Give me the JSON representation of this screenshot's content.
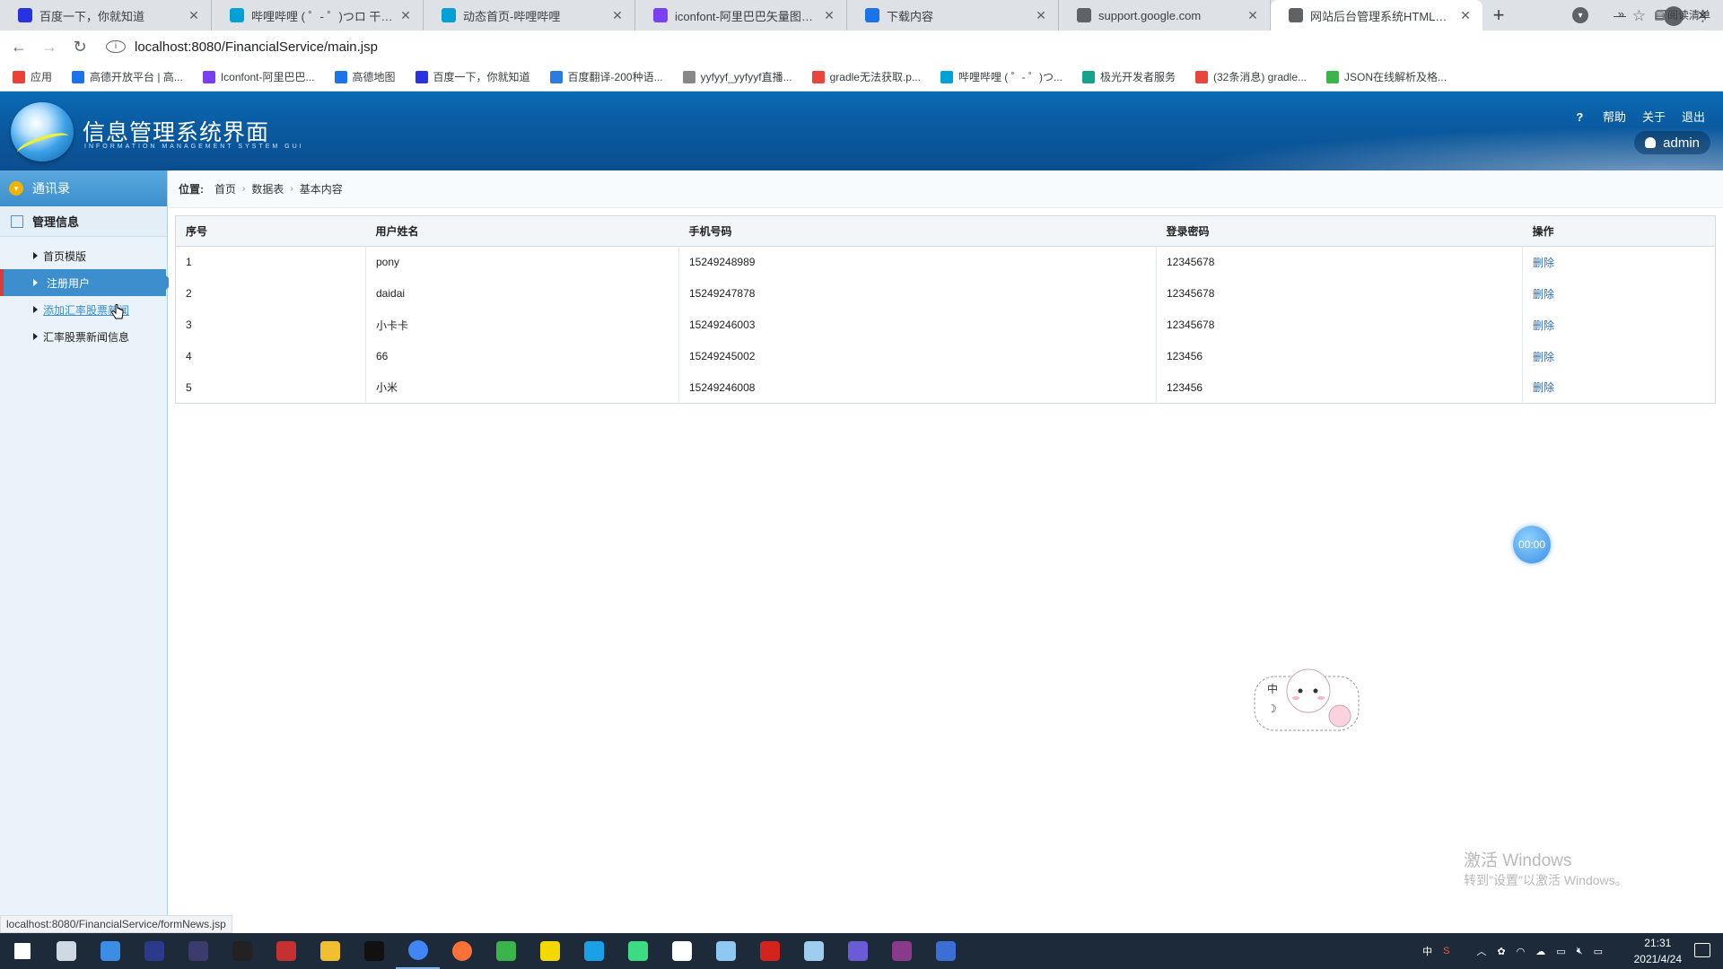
{
  "browser": {
    "tabs": [
      {
        "label": "百度一下，你就知道",
        "icon": "baidu-icon",
        "color": "#2932e1"
      },
      {
        "label": "哔哩哔哩 ( ゜- ゜)つロ 干杯~-bilibili",
        "icon": "bilibili-icon",
        "color": "#00a1d6"
      },
      {
        "label": "动态首页-哔哩哔哩",
        "icon": "bilibili-icon",
        "color": "#00a1d6"
      },
      {
        "label": "iconfont-阿里巴巴矢量图标库",
        "icon": "iconfont-icon",
        "color": "#7b3ff2"
      },
      {
        "label": "下载内容",
        "icon": "download-icon",
        "color": "#1a73e8"
      },
      {
        "label": "support.google.com",
        "icon": "globe-icon",
        "color": "#5f6368"
      },
      {
        "label": "网站后台管理系统HTML模板--",
        "icon": "page-icon",
        "color": "#5f6368"
      }
    ],
    "url": "localhost:8080/FinancialService/main.jsp",
    "bookmarks": [
      {
        "label": "应用",
        "color": "#ea4335"
      },
      {
        "label": "高德开放平台 | 高...",
        "color": "#1a73e8"
      },
      {
        "label": "Iconfont-阿里巴巴...",
        "color": "#7b3ff2"
      },
      {
        "label": "高德地图",
        "color": "#1a73e8"
      },
      {
        "label": "百度一下，你就知道",
        "color": "#2932e1"
      },
      {
        "label": "百度翻译-200种语...",
        "color": "#2c7be5"
      },
      {
        "label": "yyfyyf_yyfyyf直播...",
        "color": "#888888"
      },
      {
        "label": "gradle无法获取.p...",
        "color": "#e8453c"
      },
      {
        "label": "哔哩哔哩 ( ゜- ゜)つ...",
        "color": "#00a1d6"
      },
      {
        "label": "极光开发者服务",
        "color": "#16a38b"
      },
      {
        "label": "(32条消息) gradle...",
        "color": "#e8453c"
      },
      {
        "label": "JSON在线解析及格...",
        "color": "#3ab54a"
      }
    ],
    "bookmark_more": "»",
    "reading_list": "阅读清单",
    "status_url": "localhost:8080/FinancialService/formNews.jsp"
  },
  "app": {
    "title": "信息管理系统界面",
    "subtitle": "INFORMATION MANAGEMENT SYSTEM GUI",
    "links": {
      "help": "帮助",
      "about": "关于",
      "logout": "退出"
    },
    "user": "admin",
    "accent": "#3c8fcc"
  },
  "sidebar": {
    "header": "通讯录",
    "group": "管理信息",
    "items": [
      {
        "label": "首页模版"
      },
      {
        "label": "注册用户"
      },
      {
        "label": "添加汇率股票新闻"
      },
      {
        "label": "汇率股票新闻信息"
      }
    ]
  },
  "breadcrumb": {
    "position": "位置:",
    "items": [
      "首页",
      "数据表",
      "基本内容"
    ]
  },
  "table": {
    "headers": [
      "序号",
      "用户姓名",
      "手机号码",
      "登录密码",
      "操作"
    ],
    "rows": [
      [
        "1",
        "pony",
        "15249248989",
        "12345678",
        "删除"
      ],
      [
        "2",
        "daidai",
        "15249247878",
        "12345678",
        "删除"
      ],
      [
        "3",
        "小卡卡",
        "15249246003",
        "12345678",
        "删除"
      ],
      [
        "4",
        "66",
        "15249245002",
        "123456",
        "删除"
      ],
      [
        "5",
        "小米",
        "15249246008",
        "123456",
        "删除"
      ]
    ]
  },
  "overlay": {
    "timer": "00:00",
    "mascot_badge": "中",
    "watermark_line1": "激活 Windows",
    "watermark_line2": "转到\"设置\"以激活 Windows。"
  },
  "taskbar": {
    "icons": [
      "windows-start-icon",
      "task-view-icon",
      "store-icon",
      "eclipse-icon",
      "obs-icon",
      "terminal-icon",
      "steam-icon",
      "file-explorer-icon",
      "qq-icon",
      "chrome-icon",
      "firefox-icon",
      "wechat-icon",
      "pycharm-icon",
      "idea-icon",
      "android-studio-icon",
      "app-icon",
      "notepad-icon",
      "wps-icon",
      "sublime-icon",
      "browser-icon",
      "winrar-icon",
      "edge-icon"
    ],
    "icon_colors": [
      "#ffffff",
      "#cfd8e3",
      "#3a8ee6",
      "#2c3a8c",
      "#3b3b6d",
      "#222222",
      "#c53030",
      "#f0c030",
      "#111111",
      "#4285f4",
      "#ff7139",
      "#3ab54a",
      "#f5d800",
      "#1aa0e6",
      "#3ddc84",
      "#ffffff",
      "#8fc8f0",
      "#d4221c",
      "#9fcdf0",
      "#6b5bd6",
      "#8a3a8a",
      "#3b6fd6"
    ],
    "ime": "中",
    "time": "21:31",
    "date": "2021/4/24"
  }
}
